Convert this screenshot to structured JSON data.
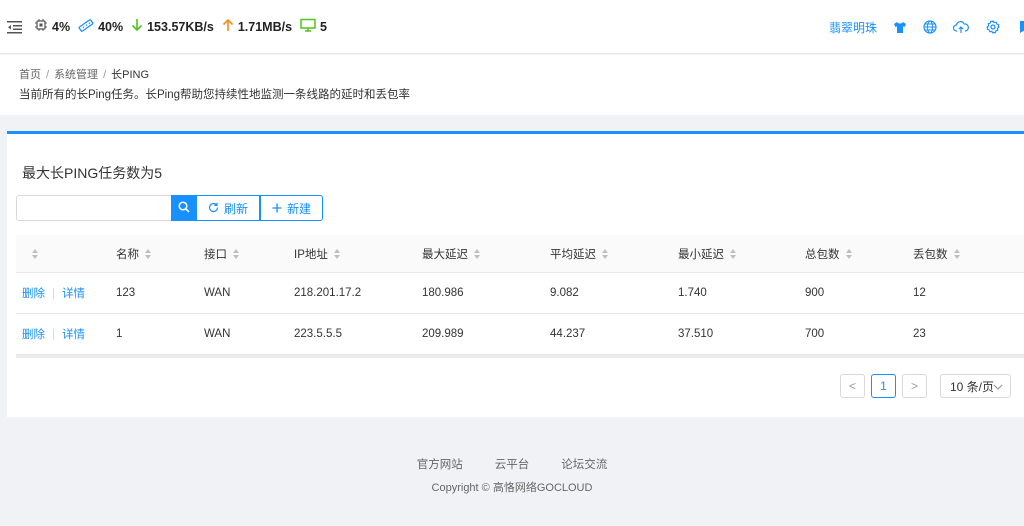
{
  "topbar": {
    "cpu": "4%",
    "memory": "40%",
    "download": "153.57KB/s",
    "upload": "1.71MB/s",
    "devices": "5",
    "user_name": "翡翠明珠",
    "icons": [
      "menu-fold-icon",
      "cpu-icon",
      "memory-icon",
      "arrow-down-icon",
      "arrow-up-icon",
      "monitor-icon",
      "skin-icon",
      "globe-icon",
      "cloud-upload-icon",
      "settings-icon",
      "book-icon"
    ],
    "colors": {
      "download": "#52c41a",
      "upload": "#fa8c16",
      "devices": "#52c41a",
      "accent": "#1890ff"
    }
  },
  "breadcrumb": {
    "items": [
      "首页",
      "系统管理",
      "长PING"
    ],
    "separator": "/"
  },
  "page_desc": "当前所有的长Ping任务。长Ping帮助您持续性地监测一条线路的延时和丢包率",
  "card": {
    "title": "最大长PING任务数为5",
    "search_placeholder": "",
    "search_value": "",
    "refresh_label": "刷新",
    "create_label": "新建"
  },
  "table": {
    "columns": [
      "",
      "名称",
      "接口",
      "IP地址",
      "最大延迟",
      "平均延迟",
      "最小延迟",
      "总包数",
      "丢包数"
    ],
    "action_delete": "删除",
    "action_detail": "详情",
    "rows": [
      {
        "name": "123",
        "iface": "WAN",
        "ip": "218.201.17.2",
        "max": "180.986",
        "avg": "9.082",
        "min": "1.740",
        "total": "900",
        "lost": "12"
      },
      {
        "name": "1",
        "iface": "WAN",
        "ip": "223.5.5.5",
        "max": "209.989",
        "avg": "44.237",
        "min": "37.510",
        "total": "700",
        "lost": "23"
      }
    ]
  },
  "pagination": {
    "prev": "<",
    "current": "1",
    "next": ">",
    "page_size": "10 条/页"
  },
  "footer": {
    "links": [
      "官方网站",
      "云平台",
      "论坛交流"
    ],
    "copyright": "Copyright © 高恪网络GOCLOUD"
  }
}
